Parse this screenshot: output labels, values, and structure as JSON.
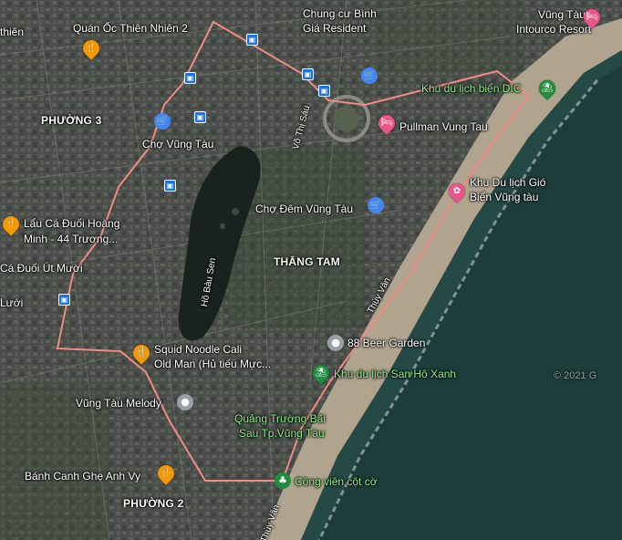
{
  "map": {
    "districts": {
      "phuong3": "PHƯỜNG 3",
      "thang_tam": "THẮNG TAM",
      "phuong2": "PHƯỜNG 2"
    },
    "streets": {
      "vo_thi_sau": "Võ Thị Sáu",
      "thuy_van": "Thùy Vân",
      "thuy_van_south": "Thùy Vân"
    },
    "water": {
      "lake": "Hồ Bàu Sen"
    },
    "places": {
      "thien": "thiên",
      "quan_oc": "Quán Ốc Thiên Nhiên 2",
      "chung_cu_line1": "Chung cư Bình",
      "chung_cu_line2": "Giá Resident",
      "intourco_line1": "Vũng Tàu",
      "intourco_line2": "Intourco Resort",
      "khu_dic": "Khu du lịch biển DIC",
      "pullman": "Pullman Vung Tau",
      "cho_vung_tau": "Chợ Vũng Tàu",
      "khu_gio_line1": "Khu Du lịch Gió",
      "khu_gio_line2": "Biển Vũng tàu",
      "cho_dem": "Chợ Đêm Vũng Tàu",
      "lau_ca_line1": "Lẩu Cá Đuối Hoàng",
      "lau_ca_line2": "Minh - 44 Trương...",
      "ca_duoi": "Cá Đuối Út Mười",
      "luoi": "Lưới",
      "beer_garden": "88 Beer Garden",
      "squid_line1": "Squid Noodle Cali",
      "squid_line2": "Old Man (Hủ tiếu Mực...",
      "san_ho": "Khu du lịch San Hô Xanh",
      "melody": "Vũng Tàu Melody",
      "quang_truong_line1": "Quảng Trường Bãi",
      "quang_truong_line2": "Sau Tp.Vũng Tàu",
      "banh_canh": "Bánh Canh Ghẹ Anh Vy",
      "cong_vien": "Công viên cột cờ"
    },
    "watermark": "© 2021 G"
  },
  "colors": {
    "route": "#f28b82",
    "sea": "#1d3d3a",
    "lake": "#18221f",
    "food_pin": "#f29900",
    "shop_pin": "#4285f4",
    "hotel_pin": "#e8578a",
    "park_pin": "#1e8e3e",
    "gray_pin": "#9aa0a6"
  }
}
